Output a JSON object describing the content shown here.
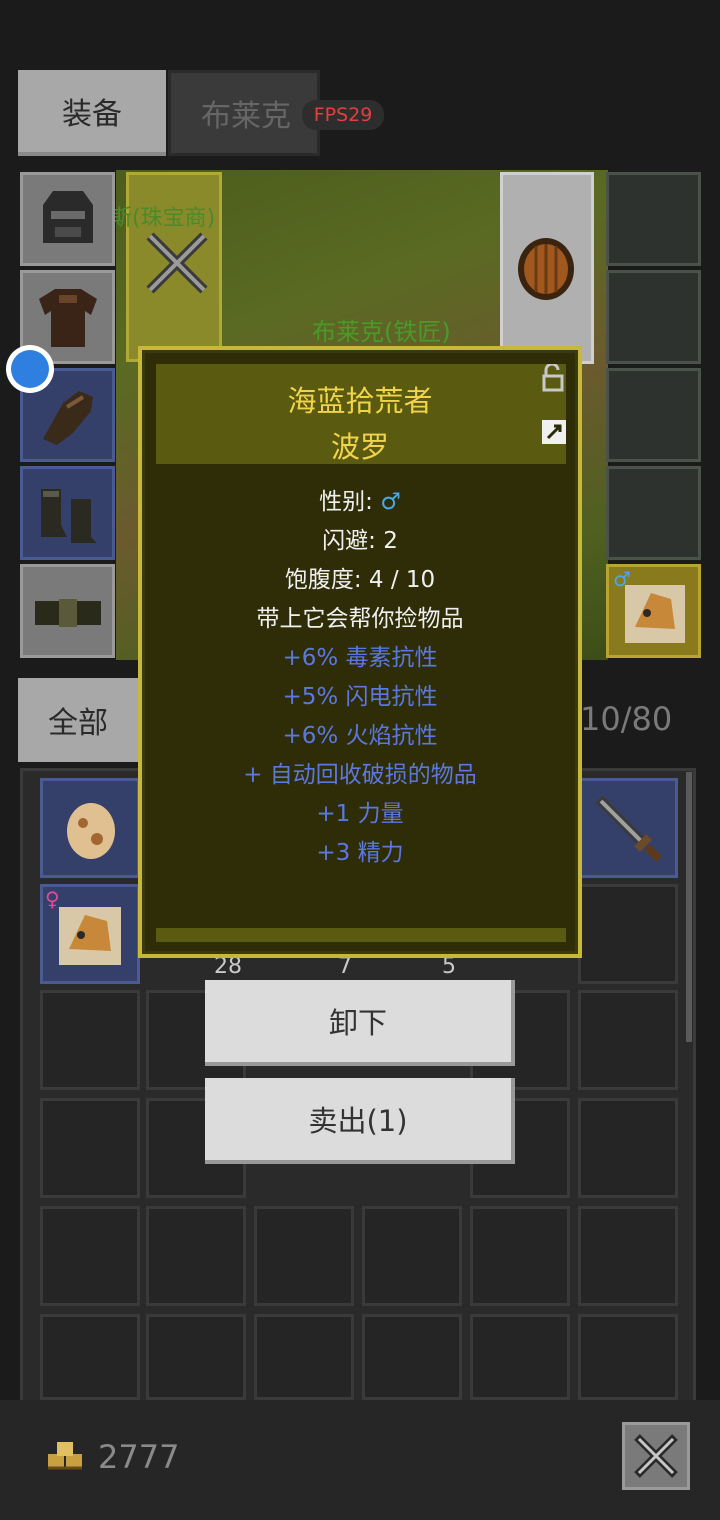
{
  "tabs": {
    "equip": "装备",
    "npc": "布莱克"
  },
  "fps": "FPS29",
  "scene": {
    "merchant_label": "斯(珠宝商)",
    "smith_label": "布莱克(铁匠)"
  },
  "filter": {
    "all": "全部"
  },
  "inventory": {
    "count": "10/80",
    "stack_counts": [
      "28",
      "7",
      "5"
    ]
  },
  "gold": "2777",
  "popup": {
    "title": "海蓝拾荒者",
    "name": "波罗",
    "gender_label": "性别: ",
    "gender_symbol": "♂",
    "evasion": "闪避: 2",
    "satiety": "饱腹度: 4 / 10",
    "description": "带上它会帮你捡物品",
    "bonuses": [
      "+6% 毒素抗性",
      "+5% 闪电抗性",
      "+6% 火焰抗性",
      "+ 自动回收破损的物品",
      "+1 力量",
      "+3 精力"
    ]
  },
  "buttons": {
    "unequip": "卸下",
    "sell": "卖出(1)"
  },
  "colors": {
    "accent": "#f0d44a",
    "bonus": "#5b78e0",
    "male": "#4aa8e8",
    "female": "#e04a9a",
    "fps": "#e04040"
  }
}
